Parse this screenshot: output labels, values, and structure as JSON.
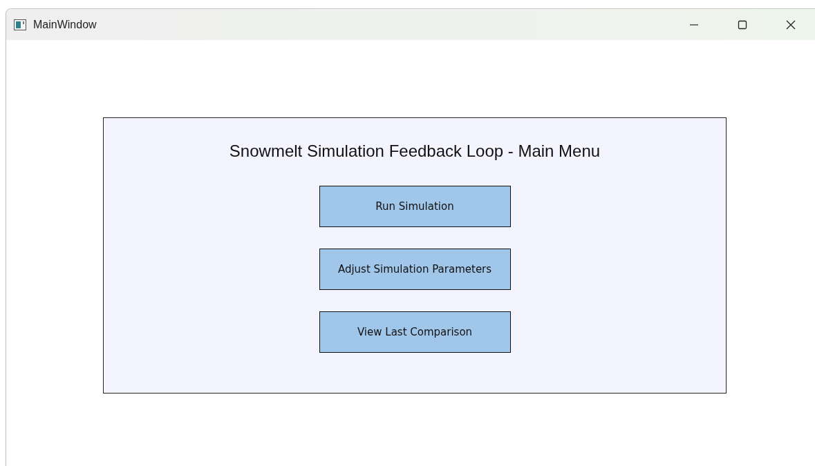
{
  "window": {
    "title": "MainWindow"
  },
  "panel": {
    "title": "Snowmelt Simulation Feedback Loop - Main Menu",
    "buttons": [
      "Run Simulation",
      "Adjust Simulation Parameters",
      "View Last Comparison"
    ]
  }
}
